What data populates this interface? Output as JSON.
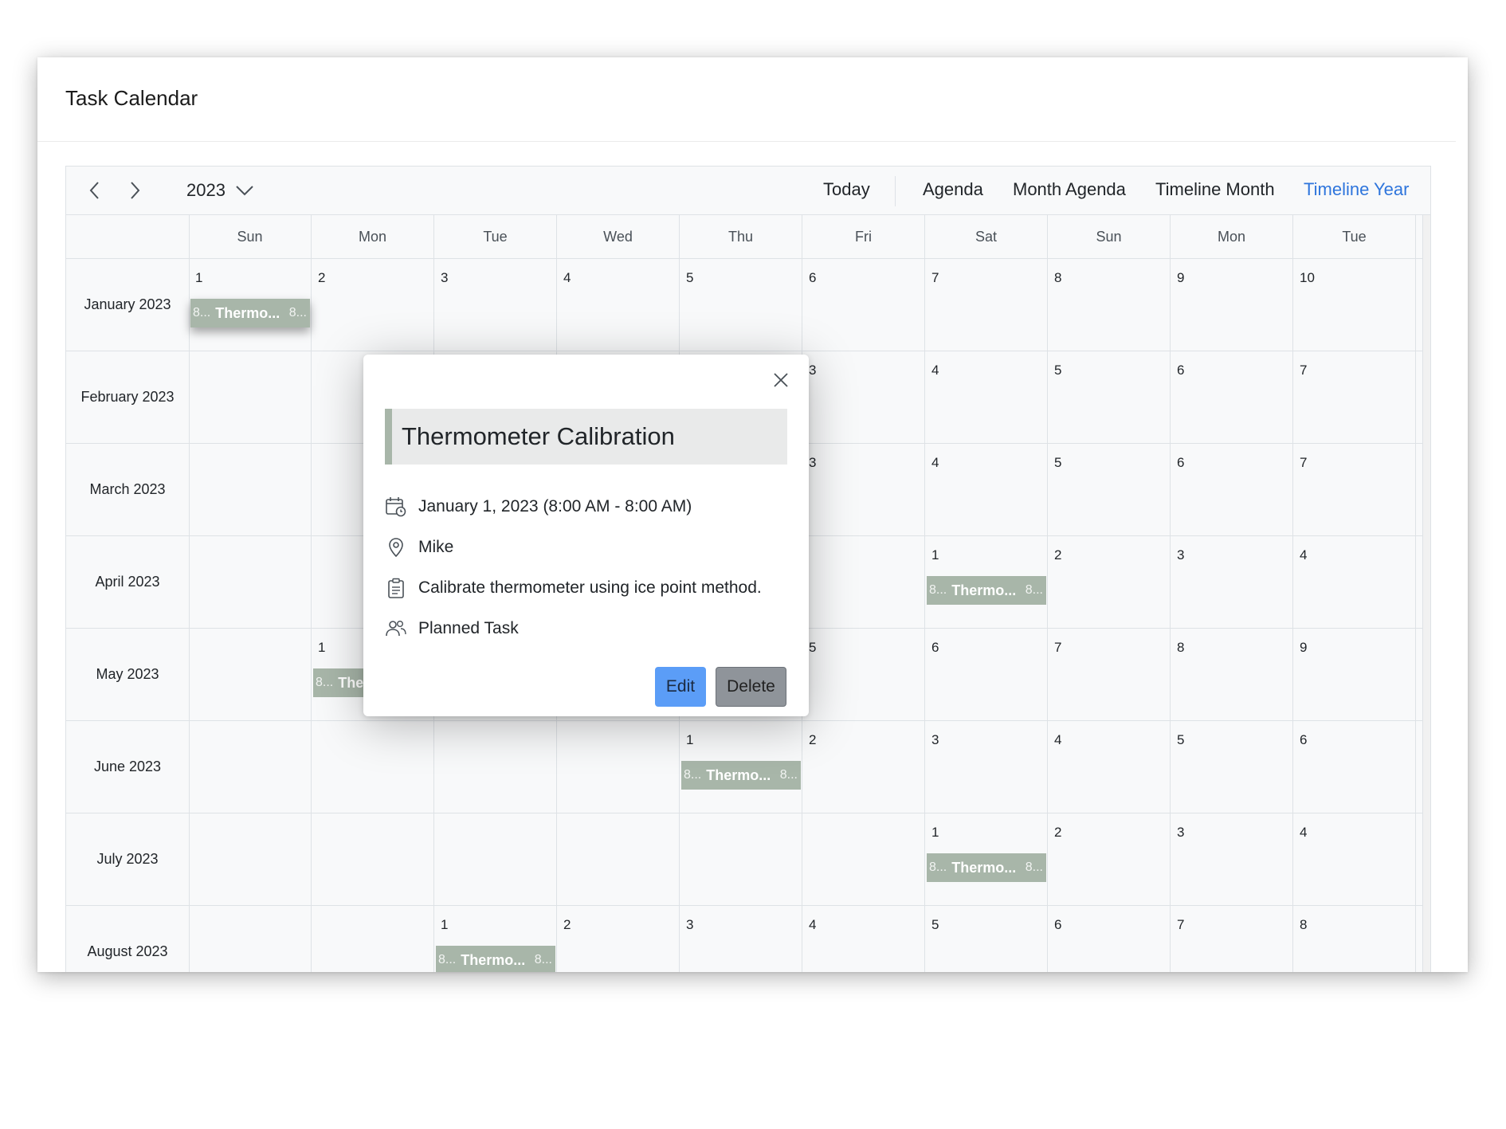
{
  "card": {
    "title": "Task Calendar"
  },
  "toolbar": {
    "year": "2023",
    "today_label": "Today",
    "views": [
      {
        "label": "Agenda",
        "active": false
      },
      {
        "label": "Month Agenda",
        "active": false
      },
      {
        "label": "Timeline Month",
        "active": false
      },
      {
        "label": "Timeline Year",
        "active": true
      }
    ],
    "icons": {
      "prev": "chevron-left-icon",
      "next": "chevron-right-icon",
      "dropdown": "chevron-down-icon"
    }
  },
  "calendar": {
    "day_headers": [
      "Sun",
      "Mon",
      "Tue",
      "Wed",
      "Thu",
      "Fri",
      "Sat",
      "Sun",
      "Mon",
      "Tue"
    ],
    "rows": [
      {
        "month": "January 2023",
        "cells": [
          "1",
          "2",
          "3",
          "4",
          "5",
          "6",
          "7",
          "8",
          "9",
          "10"
        ]
      },
      {
        "month": "February 2023",
        "cells": [
          "",
          "",
          "",
          "",
          "",
          "3",
          "4",
          "5",
          "6",
          "7"
        ]
      },
      {
        "month": "March 2023",
        "cells": [
          "",
          "",
          "",
          "",
          "",
          "3",
          "4",
          "5",
          "6",
          "7"
        ]
      },
      {
        "month": "April 2023",
        "cells": [
          "",
          "",
          "",
          "",
          "",
          "",
          "1",
          "2",
          "3",
          "4"
        ]
      },
      {
        "month": "May 2023",
        "cells": [
          "",
          "1",
          "",
          "",
          "",
          "5",
          "6",
          "7",
          "8",
          "9"
        ]
      },
      {
        "month": "June 2023",
        "cells": [
          "",
          "",
          "",
          "",
          "1",
          "2",
          "3",
          "4",
          "5",
          "6"
        ]
      },
      {
        "month": "July 2023",
        "cells": [
          "",
          "",
          "",
          "",
          "",
          "",
          "1",
          "2",
          "3",
          "4"
        ]
      },
      {
        "month": "August 2023",
        "cells": [
          "",
          "",
          "1",
          "2",
          "3",
          "4",
          "5",
          "6",
          "7",
          "8"
        ]
      }
    ],
    "event": {
      "start_short": "8...",
      "title_short": "Thermo...",
      "end_short": "8..."
    },
    "event_positions": [
      {
        "row": 0,
        "col": 0
      },
      {
        "row": 3,
        "col": 6
      },
      {
        "row": 4,
        "col": 1
      },
      {
        "row": 5,
        "col": 4
      },
      {
        "row": 6,
        "col": 6
      },
      {
        "row": 7,
        "col": 2
      }
    ],
    "colors": {
      "event": "#a8b6a9",
      "active_view": "#2e75dc",
      "edit_button": "#5b9df7",
      "delete_button": "#8f949a"
    }
  },
  "popup": {
    "subject": "Thermometer Calibration",
    "datetime": "January 1, 2023 (8:00 AM - 8:00 AM)",
    "location": "Mike",
    "description": "Calibrate thermometer using ice point method.",
    "resource": "Planned Task",
    "edit_label": "Edit",
    "delete_label": "Delete",
    "icons": [
      "calendar-clock-icon",
      "location-pin-icon",
      "clipboard-icon",
      "people-icon",
      "close-icon"
    ]
  }
}
